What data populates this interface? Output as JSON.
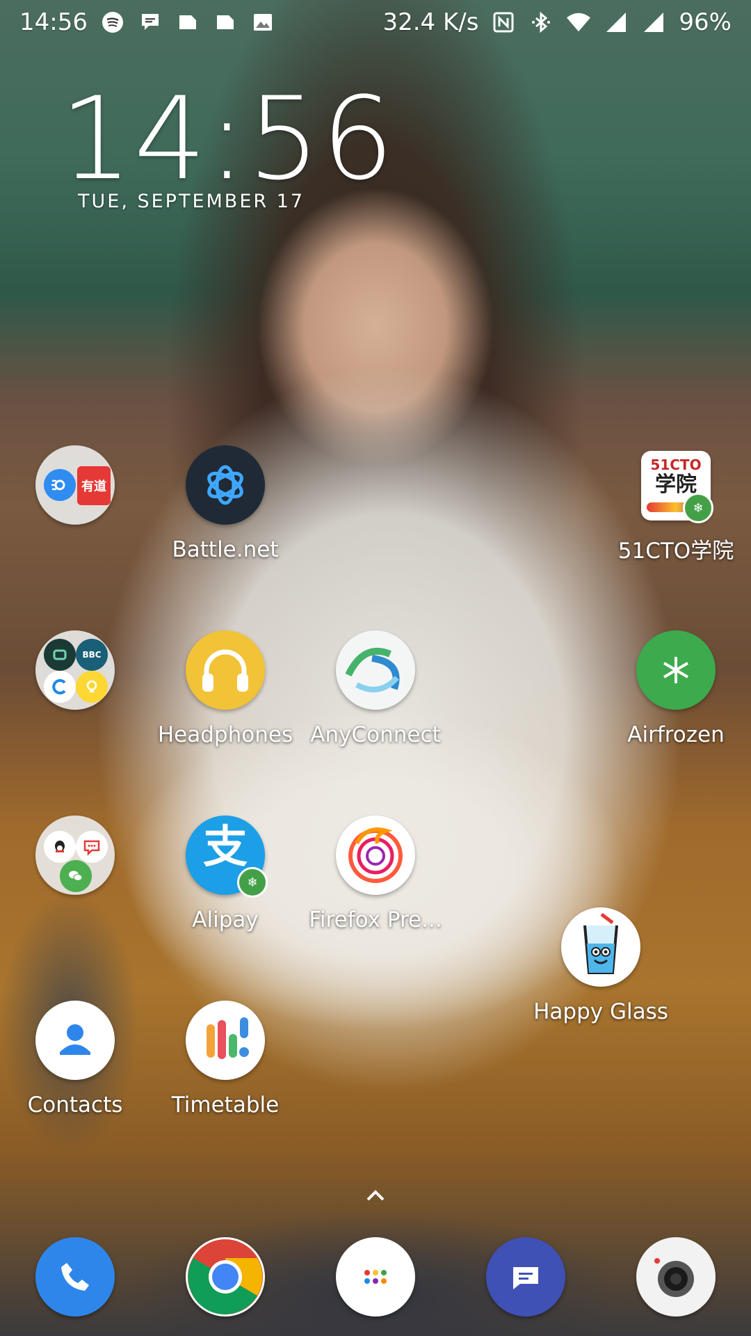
{
  "status_bar": {
    "time": "14:56",
    "net_speed": "32.4 K/s",
    "battery": "96%",
    "notification_icons": [
      "spotify-icon",
      "chat-bubble-icon",
      "sd-card-icon",
      "sd-card-icon",
      "image-icon"
    ],
    "system_icons": [
      "nfc-icon",
      "bluetooth-icon",
      "wifi-icon",
      "signal-icon",
      "signal-icon"
    ]
  },
  "clock_widget": {
    "time": "14:56",
    "date": "TUE, SEPTEMBER 17"
  },
  "apps": [
    {
      "label": "",
      "icon": "folder-icon"
    },
    {
      "label": "Battle.net",
      "icon": "battlenet-icon"
    },
    {
      "label": "51CTO学院",
      "icon": "51cto-icon",
      "icon_text_1": "51CTO",
      "icon_text_2": "学院"
    },
    {
      "label": "",
      "icon": "folder-icon"
    },
    {
      "label": "Headphones",
      "icon": "headphones-icon"
    },
    {
      "label": "AnyConnect",
      "icon": "anyconnect-icon"
    },
    {
      "label": "Airfrozen",
      "icon": "snowflake-icon"
    },
    {
      "label": "",
      "icon": "folder-icon"
    },
    {
      "label": "Alipay",
      "icon": "alipay-icon",
      "icon_text": "支"
    },
    {
      "label": "Firefox Pre...",
      "icon": "firefox-icon"
    },
    {
      "label": "Happy Glass",
      "icon": "happy-glass-icon"
    },
    {
      "label": "Contacts",
      "icon": "contacts-icon"
    },
    {
      "label": "Timetable",
      "icon": "timetable-icon"
    }
  ],
  "folders": {
    "folder_1_items": [
      "speed-icon",
      "youdao-icon"
    ],
    "folder_1_youdao_text": "有道",
    "folder_2_items": [
      "dashcam-icon",
      "bbc-learning-english-icon",
      "c-icon",
      "lightbulb-icon"
    ],
    "folder_2_bbc_text": "BBC",
    "folder_3_items": [
      "qq-icon",
      "chat-icon",
      "wechat-icon"
    ]
  },
  "dock": [
    "phone-icon",
    "chrome-icon",
    "app-drawer-icon",
    "messages-icon",
    "camera-icon"
  ],
  "colors": {
    "battlenet_bg": "#1f2a36",
    "headphones": "#f2c237",
    "airfrozen": "#3daa4d",
    "alipay": "#1c9fe6",
    "phone": "#2f86ea",
    "messages": "#3f51b5",
    "contacts": "#2f86ea",
    "badge": "#43a047"
  }
}
